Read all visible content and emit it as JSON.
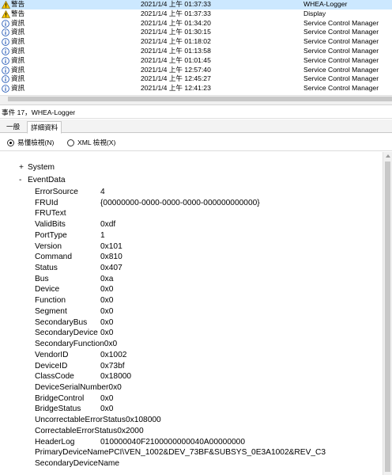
{
  "events": [
    {
      "level": "警告",
      "icon": "warning-icon",
      "datetime": "2021/1/4 上午 01:37:33",
      "source": "WHEA-Logger",
      "selected": true
    },
    {
      "level": "警告",
      "icon": "warning-icon",
      "datetime": "2021/1/4 上午 01:37:33",
      "source": "Display",
      "selected": false
    },
    {
      "level": "資訊",
      "icon": "info-icon",
      "datetime": "2021/1/4 上午 01:34:20",
      "source": "Service Control Manager",
      "selected": false
    },
    {
      "level": "資訊",
      "icon": "info-icon",
      "datetime": "2021/1/4 上午 01:30:15",
      "source": "Service Control Manager",
      "selected": false
    },
    {
      "level": "資訊",
      "icon": "info-icon",
      "datetime": "2021/1/4 上午 01:18:02",
      "source": "Service Control Manager",
      "selected": false
    },
    {
      "level": "資訊",
      "icon": "info-icon",
      "datetime": "2021/1/4 上午 01:13:58",
      "source": "Service Control Manager",
      "selected": false
    },
    {
      "level": "資訊",
      "icon": "info-icon",
      "datetime": "2021/1/4 上午 01:01:45",
      "source": "Service Control Manager",
      "selected": false
    },
    {
      "level": "資訊",
      "icon": "info-icon",
      "datetime": "2021/1/4 上午 12:57:40",
      "source": "Service Control Manager",
      "selected": false
    },
    {
      "level": "資訊",
      "icon": "info-icon",
      "datetime": "2021/1/4 上午 12:45:27",
      "source": "Service Control Manager",
      "selected": false
    },
    {
      "level": "資訊",
      "icon": "info-icon",
      "datetime": "2021/1/4 上午 12:41:23",
      "source": "Service Control Manager",
      "selected": false
    }
  ],
  "detail": {
    "title": "事件 17，WHEA-Logger",
    "tabs": [
      "一般",
      "詳細資料"
    ],
    "active_tab": "詳細資料",
    "view_modes": {
      "friendly": "易懂檢視(N)",
      "xml": "XML 檢視(X)",
      "selected": "friendly"
    }
  },
  "tree": {
    "system": {
      "toggle": "+",
      "label": "System"
    },
    "eventdata": {
      "toggle": "-",
      "label": "EventData"
    },
    "fields": [
      {
        "key": "ErrorSource",
        "value": "4"
      },
      {
        "key": "FRUId",
        "value": "{00000000-0000-0000-0000-000000000000}"
      },
      {
        "key": "FRUText",
        "value": ""
      },
      {
        "key": "ValidBits",
        "value": "0xdf"
      },
      {
        "key": "PortType",
        "value": "1"
      },
      {
        "key": "Version",
        "value": "0x101"
      },
      {
        "key": "Command",
        "value": "0x810"
      },
      {
        "key": "Status",
        "value": "0x407"
      },
      {
        "key": "Bus",
        "value": "0xa"
      },
      {
        "key": "Device",
        "value": "0x0"
      },
      {
        "key": "Function",
        "value": "0x0"
      },
      {
        "key": "Segment",
        "value": "0x0"
      },
      {
        "key": "SecondaryBus",
        "value": "0x0"
      },
      {
        "key": "SecondaryDevice",
        "value": "0x0"
      },
      {
        "key": "SecondaryFunction",
        "value": "0x0"
      },
      {
        "key": "VendorID",
        "value": "0x1002"
      },
      {
        "key": "DeviceID",
        "value": "0x73bf"
      },
      {
        "key": "ClassCode",
        "value": "0x18000"
      },
      {
        "key": "DeviceSerialNumber",
        "value": "0x0"
      },
      {
        "key": "BridgeControl",
        "value": "0x0"
      },
      {
        "key": "BridgeStatus",
        "value": "0x0"
      },
      {
        "key": "UncorrectableErrorStatus",
        "value": "0x108000"
      },
      {
        "key": "CorrectableErrorStatus",
        "value": "0x2000"
      },
      {
        "key": "HeaderLog",
        "value": "010000040F2100000000040A00000000"
      },
      {
        "key": "PrimaryDeviceName",
        "value": "PCI\\VEN_1002&DEV_73BF&SUBSYS_0E3A1002&REV_C3"
      },
      {
        "key": "SecondaryDeviceName",
        "value": ""
      }
    ]
  },
  "colors": {
    "warning": "#f2c200",
    "info": "#2b5eb8",
    "selection": "#cce8ff"
  }
}
